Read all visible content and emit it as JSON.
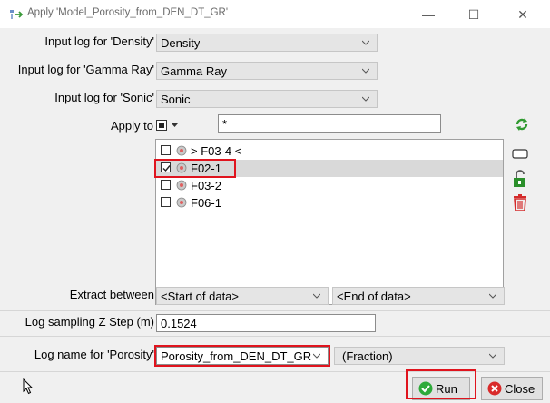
{
  "window": {
    "title": "Apply 'Model_Porosity_from_DEN_DT_GR'",
    "minimize": "—",
    "maximize": "☐",
    "close": "✕"
  },
  "inputs": [
    {
      "label": "Input log for 'Density'",
      "value": "Density"
    },
    {
      "label": "Input log for 'Gamma Ray'",
      "value": "Gamma Ray"
    },
    {
      "label": "Input log for 'Sonic'",
      "value": "Sonic"
    }
  ],
  "apply_to": {
    "label": "Apply to",
    "filter_value": "*"
  },
  "wells": [
    {
      "name": "> F03-4 <",
      "checked": false,
      "selected": false
    },
    {
      "name": "F02-1",
      "checked": true,
      "selected": true
    },
    {
      "name": "F03-2",
      "checked": false,
      "selected": false
    },
    {
      "name": "F06-1",
      "checked": false,
      "selected": false
    }
  ],
  "extract": {
    "label": "Extract between",
    "start": "<Start of data>",
    "end": "<End of data>"
  },
  "sampling": {
    "label": "Log sampling Z Step (m)",
    "value": "0.1524"
  },
  "output": {
    "label": "Log name for 'Porosity'",
    "value": "Porosity_from_DEN_DT_GR",
    "unit": "(Fraction)"
  },
  "buttons": {
    "run": "Run",
    "close": "Close"
  },
  "colors": {
    "highlight": "#e0141e",
    "run_icon": "#2eaa3a",
    "close_icon": "#d92a2a"
  }
}
